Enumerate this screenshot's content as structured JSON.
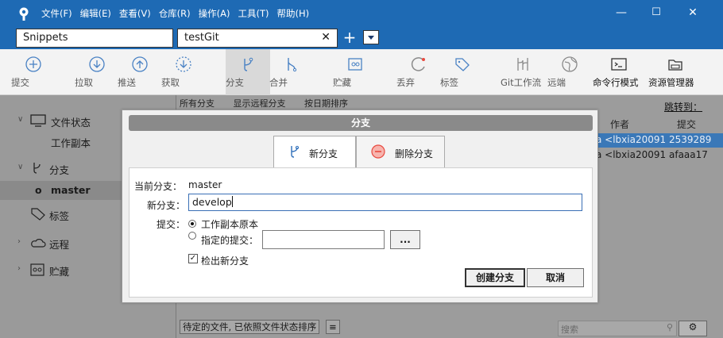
{
  "menu": [
    "文件(F)",
    "编辑(E)",
    "查看(V)",
    "仓库(R)",
    "操作(A)",
    "工具(T)",
    "帮助(H)"
  ],
  "window_controls": {
    "minimize": "—",
    "maximize": "☐",
    "close": "✕"
  },
  "tabs": [
    {
      "label": "Snippets"
    },
    {
      "label": "testGit",
      "close": "✕"
    }
  ],
  "tab_add": "+",
  "toolbar": [
    {
      "label": "提交",
      "icon": "commit-icon"
    },
    {
      "label": "拉取",
      "icon": "pull-icon"
    },
    {
      "label": "推送",
      "icon": "push-icon"
    },
    {
      "label": "获取",
      "icon": "fetch-icon"
    },
    {
      "label": "分支",
      "icon": "branch-icon"
    },
    {
      "label": "合并",
      "icon": "merge-icon"
    },
    {
      "label": "贮藏",
      "icon": "stash-icon"
    },
    {
      "label": "丢弃",
      "icon": "discard-icon"
    },
    {
      "label": "标签",
      "icon": "tag-icon"
    },
    {
      "label": "Git工作流",
      "icon": "gitflow-icon"
    },
    {
      "label": "远端",
      "icon": "remote-icon"
    },
    {
      "label": "命令行模式",
      "icon": "terminal-icon"
    },
    {
      "label": "资源管理器",
      "icon": "explorer-icon"
    }
  ],
  "sidebar": {
    "file_status": "文件状态",
    "working_copy": "工作副本",
    "branches": "分支",
    "current_branch": "master",
    "tags": "标签",
    "remotes": "远程",
    "stashes": "贮藏"
  },
  "history": {
    "filter_all_branches": "所有分支",
    "show_remote": "显示远程分支",
    "sort_by_date": "按日期排序",
    "jump_to": "跳转到：",
    "col_author": "作者",
    "col_commit": "提交",
    "rows": [
      {
        "author": "a <lbxia20091",
        "commit": "2539289"
      },
      {
        "author": "a <lbxia20091",
        "commit": "afaaa17"
      }
    ],
    "pending_sort": "待定的文件, 已依照文件状态排序",
    "search_placeholder": "搜索"
  },
  "dialog": {
    "title": "分支",
    "tab_new": "新分支",
    "tab_delete": "删除分支",
    "current_branch_label": "当前分支：",
    "current_branch_value": "master",
    "new_branch_label": "新分支：",
    "new_branch_value": "develop",
    "commit_label": "提交：",
    "option_working_copy": "工作副本原本",
    "option_specified": "指定的提交：",
    "browse": "...",
    "checkout_label": "检出新分支",
    "create_button": "创建分支",
    "cancel_button": "取消"
  },
  "colors": {
    "accent": "#1e6ab4",
    "selection": "#3a78b8",
    "danger": "#e8493f"
  }
}
